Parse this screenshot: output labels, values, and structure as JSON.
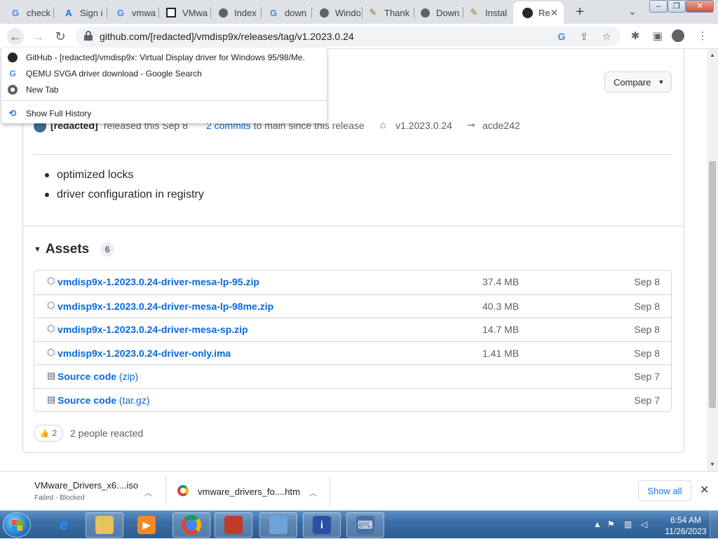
{
  "tabs": [
    {
      "label": "check",
      "icon": "google-icon"
    },
    {
      "label": "Sign i",
      "icon": "azure-icon"
    },
    {
      "label": "vmwa",
      "icon": "google-icon"
    },
    {
      "label": "VMwa",
      "icon": "archive-icon"
    },
    {
      "label": "Index",
      "icon": "globe-icon"
    },
    {
      "label": "down",
      "icon": "google-icon"
    },
    {
      "label": "Windo",
      "icon": "globe-icon"
    },
    {
      "label": "Thank",
      "icon": "wrench-icon"
    },
    {
      "label": "Down",
      "icon": "globe-icon"
    },
    {
      "label": "Instal",
      "icon": "wrench-icon"
    },
    {
      "label": "Re",
      "icon": "github-icon",
      "active": true
    }
  ],
  "toolbar": {
    "url": "github.com/[redacted]/vmdisp9x/releases/tag/v1.2023.0.24"
  },
  "history_menu": {
    "items": [
      {
        "label": "GitHub - [redacted]/vmdisp9x: Virtual Display driver for Windows 95/98/Me.",
        "icon": "github-icon"
      },
      {
        "label": "QEMU SVGA driver download - Google Search",
        "icon": "google-icon"
      },
      {
        "label": "New Tab",
        "icon": "chrome-icon"
      }
    ],
    "show_full": "Show Full History"
  },
  "release": {
    "compare_label": "Compare",
    "author": "[redacted]",
    "released_text": "released this Sep 8",
    "commits_link": "2 commits",
    "commits_text": "to main since this release",
    "tag": "v1.2023.0.24",
    "commit": "acde242",
    "notes": [
      "optimized locks",
      "driver configuration in registry"
    ]
  },
  "assets": {
    "title": "Assets",
    "count": "6",
    "rows": [
      {
        "name": "vmdisp9x-1.2023.0.24-driver-mesa-lp-95.zip",
        "ext": "",
        "size": "37.4 MB",
        "date": "Sep 8",
        "icon": "package-icon"
      },
      {
        "name": "vmdisp9x-1.2023.0.24-driver-mesa-lp-98me.zip",
        "ext": "",
        "size": "40.3 MB",
        "date": "Sep 8",
        "icon": "package-icon"
      },
      {
        "name": "vmdisp9x-1.2023.0.24-driver-mesa-sp.zip",
        "ext": "",
        "size": "14.7 MB",
        "date": "Sep 8",
        "icon": "package-icon"
      },
      {
        "name": "vmdisp9x-1.2023.0.24-driver-only.ima",
        "ext": "",
        "size": "1.41 MB",
        "date": "Sep 8",
        "icon": "package-icon"
      },
      {
        "name": "Source code",
        "ext": " (zip)",
        "size": "",
        "date": "Sep 7",
        "icon": "file-zip-icon"
      },
      {
        "name": "Source code",
        "ext": " (tar.gz)",
        "size": "",
        "date": "Sep 7",
        "icon": "file-zip-icon"
      }
    ]
  },
  "reactions": {
    "count": "2",
    "text": "2 people reacted"
  },
  "downloads": [
    {
      "name": "VMware_Drivers_x6....iso",
      "status": "Failed - Blocked"
    },
    {
      "name": "vmware_drivers_fo....htm",
      "status": ""
    }
  ],
  "download_bar": {
    "show_all": "Show all"
  },
  "taskbar": {
    "time": "6:54 AM",
    "date": "11/26/2023"
  },
  "colors": {
    "link": "#0969da",
    "border": "#d0d7de",
    "taskbar": "#3a6ea5"
  }
}
